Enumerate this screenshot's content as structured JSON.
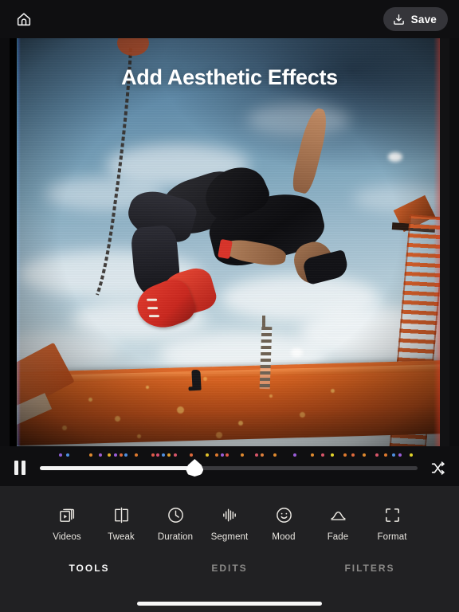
{
  "topbar": {
    "home_icon": "home-icon",
    "save_label": "Save",
    "save_icon": "download-save-icon"
  },
  "stage": {
    "title": "Add Aesthetic Effects",
    "scene_description": "Person performing a backflip in mid-air against a blue cloudy sky above an orange rooftop, with chromatic aberration and gold bokeh overlay effects",
    "effect_edge_color_red": "#ff3c28",
    "effect_edge_color_green": "#3cff5a",
    "effect_edge_color_blue": "#285aff"
  },
  "transport": {
    "play_state_icon": "pause-icon",
    "shuffle_icon": "shuffle-icon",
    "progress_percent": 41,
    "handle_icon": "teardrop-handle",
    "markers": [
      {
        "pos": 8.5,
        "color": "#8e5fd6"
      },
      {
        "pos": 11.0,
        "color": "#4f8fe0"
      },
      {
        "pos": 18.2,
        "color": "#e08a2e"
      },
      {
        "pos": 21.3,
        "color": "#a05fd0"
      },
      {
        "pos": 24.0,
        "color": "#e3b02a"
      },
      {
        "pos": 26.2,
        "color": "#9b5ed8"
      },
      {
        "pos": 27.9,
        "color": "#e06a3c"
      },
      {
        "pos": 29.4,
        "color": "#4f8fe0"
      },
      {
        "pos": 32.7,
        "color": "#e07a2e"
      },
      {
        "pos": 38.0,
        "color": "#e05a4a"
      },
      {
        "pos": 39.6,
        "color": "#d84f6e"
      },
      {
        "pos": 41.2,
        "color": "#4f8fe0"
      },
      {
        "pos": 43.0,
        "color": "#e0a02e"
      },
      {
        "pos": 45.0,
        "color": "#d8566a"
      },
      {
        "pos": 50.0,
        "color": "#e06a3c"
      },
      {
        "pos": 55.3,
        "color": "#e3c32a"
      },
      {
        "pos": 58.2,
        "color": "#e07a2e"
      },
      {
        "pos": 60.0,
        "color": "#9b5ed8"
      },
      {
        "pos": 61.6,
        "color": "#e05a4a"
      },
      {
        "pos": 66.3,
        "color": "#e08a2e"
      },
      {
        "pos": 71.0,
        "color": "#d8566a"
      },
      {
        "pos": 72.6,
        "color": "#e0803c"
      },
      {
        "pos": 76.8,
        "color": "#e08a2e"
      },
      {
        "pos": 83.0,
        "color": "#9b5ed8"
      },
      {
        "pos": 88.5,
        "color": "#e08a2e"
      },
      {
        "pos": 92.0,
        "color": "#d8566a"
      },
      {
        "pos": 95.0,
        "color": "#e3d52a"
      },
      {
        "pos": 99.0,
        "color": "#e07a2e"
      },
      {
        "pos": 101.5,
        "color": "#e06a3c"
      },
      {
        "pos": 105.0,
        "color": "#e08a2e"
      },
      {
        "pos": 109.0,
        "color": "#d8566a"
      },
      {
        "pos": 112.0,
        "color": "#e07a2e"
      },
      {
        "pos": 114.5,
        "color": "#4f8fe0"
      },
      {
        "pos": 116.5,
        "color": "#9b5ed8"
      },
      {
        "pos": 120.0,
        "color": "#e3d52a"
      }
    ]
  },
  "tools": [
    {
      "id": "videos",
      "label": "Videos",
      "icon": "video-stack-icon"
    },
    {
      "id": "tweak",
      "label": "Tweak",
      "icon": "split-panel-icon"
    },
    {
      "id": "duration",
      "label": "Duration",
      "icon": "clock-icon"
    },
    {
      "id": "segment",
      "label": "Segment",
      "icon": "waveform-icon"
    },
    {
      "id": "mood",
      "label": "Mood",
      "icon": "smiley-icon"
    },
    {
      "id": "fade",
      "label": "Fade",
      "icon": "fade-curve-icon"
    },
    {
      "id": "format",
      "label": "Format",
      "icon": "crop-brackets-icon"
    }
  ],
  "tabs": [
    {
      "id": "tools",
      "label": "TOOLS",
      "active": true
    },
    {
      "id": "edits",
      "label": "EDITS",
      "active": false
    },
    {
      "id": "filters",
      "label": "FILTERS",
      "active": false
    }
  ]
}
